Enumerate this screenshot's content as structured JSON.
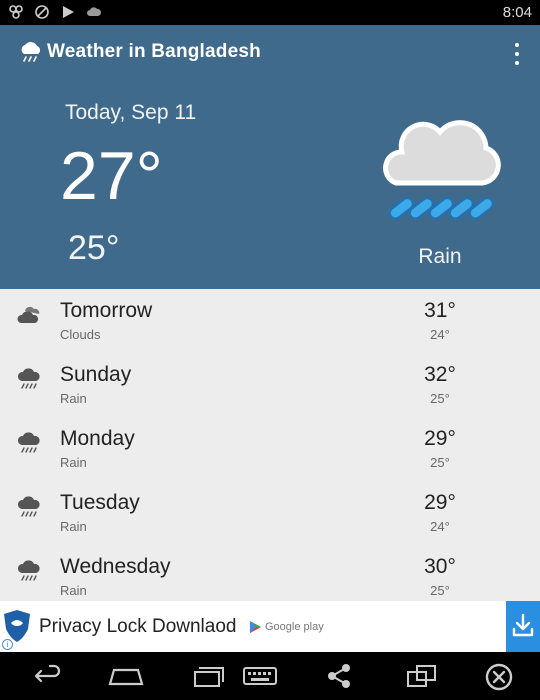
{
  "status_bar": {
    "clock": "8:04"
  },
  "app": {
    "title": "Weather in Bangladesh"
  },
  "today": {
    "date": "Today, Sep 11",
    "high": "27°",
    "low": "25°",
    "condition": "Rain"
  },
  "forecast": [
    {
      "day": "Tomorrow",
      "condition": "Clouds",
      "high": "31°",
      "low": "24°",
      "icon": "clouds-icon"
    },
    {
      "day": "Sunday",
      "condition": "Rain",
      "high": "32°",
      "low": "25°",
      "icon": "rain-icon"
    },
    {
      "day": "Monday",
      "condition": "Rain",
      "high": "29°",
      "low": "25°",
      "icon": "rain-icon"
    },
    {
      "day": "Tuesday",
      "condition": "Rain",
      "high": "29°",
      "low": "24°",
      "icon": "rain-icon"
    },
    {
      "day": "Wednesday",
      "condition": "Rain",
      "high": "30°",
      "low": "25°",
      "icon": "rain-icon"
    }
  ],
  "ad": {
    "text": "Privacy Lock Downlaod",
    "store_label": "Google play"
  },
  "colors": {
    "header_bg": "#3f6a8c",
    "list_bg": "#ededed",
    "ad_button": "#2a8fe0"
  }
}
